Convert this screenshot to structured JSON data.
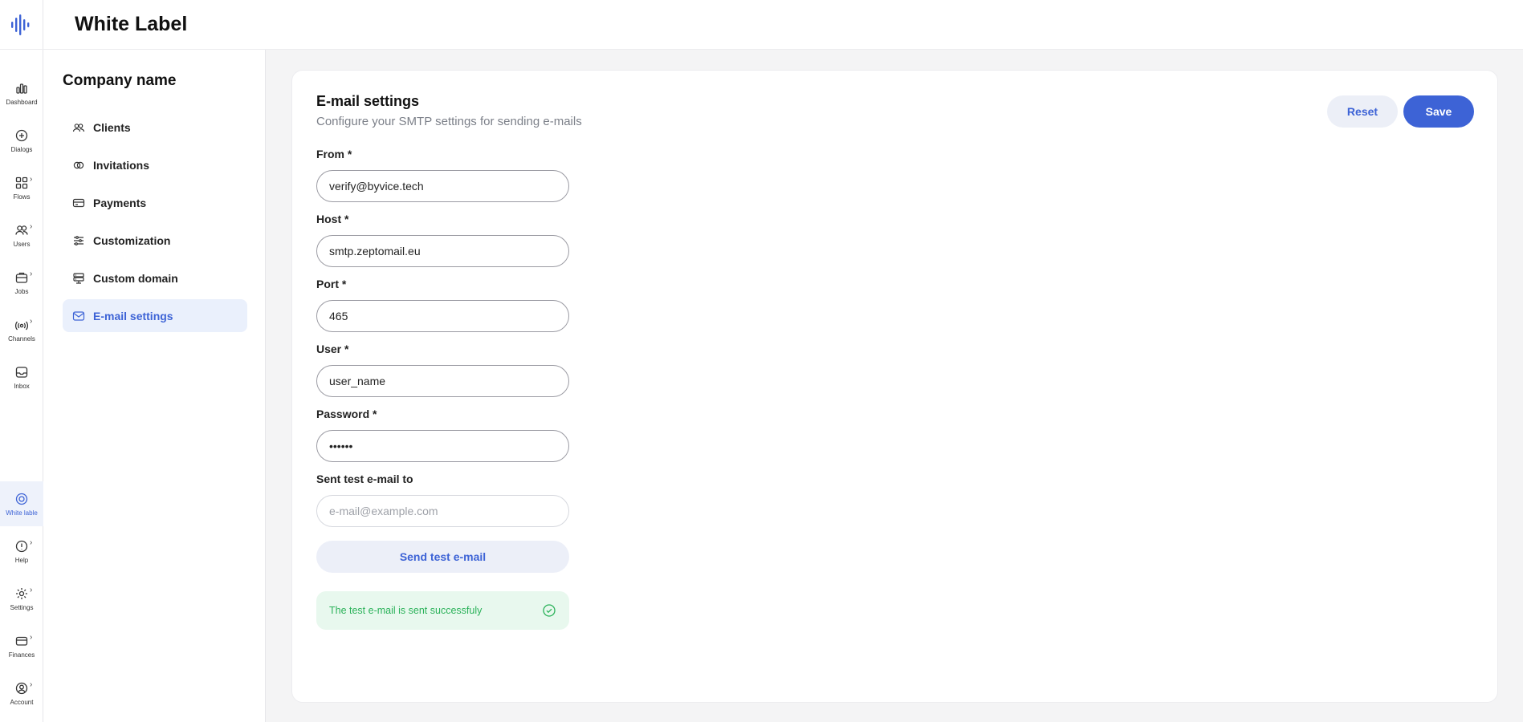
{
  "app": {
    "title": "White Label"
  },
  "rail": {
    "items": [
      {
        "label": "Dashboard",
        "icon": "bar-chart-icon",
        "chevron": false
      },
      {
        "label": "Dialogs",
        "icon": "chat-icon",
        "chevron": false
      },
      {
        "label": "Flows",
        "icon": "grid-icon",
        "chevron": true
      },
      {
        "label": "Users",
        "icon": "users-icon",
        "chevron": true
      },
      {
        "label": "Jobs",
        "icon": "briefcase-icon",
        "chevron": true
      },
      {
        "label": "Channels",
        "icon": "broadcast-icon",
        "chevron": true
      },
      {
        "label": "Inbox",
        "icon": "inbox-icon",
        "chevron": false
      },
      {
        "label": "White lable",
        "icon": "badge-icon",
        "chevron": false,
        "active": true
      },
      {
        "label": "Help",
        "icon": "help-icon",
        "chevron": true
      },
      {
        "label": "Settings",
        "icon": "gear-icon",
        "chevron": true
      },
      {
        "label": "Finances",
        "icon": "wallet-icon",
        "chevron": true
      },
      {
        "label": "Account",
        "icon": "account-icon",
        "chevron": true
      }
    ],
    "chevron_glyph": "›"
  },
  "subnav": {
    "company": "Company name",
    "items": [
      {
        "label": "Clients",
        "icon": "clients-icon"
      },
      {
        "label": "Invitations",
        "icon": "link-icon"
      },
      {
        "label": "Payments",
        "icon": "card-icon"
      },
      {
        "label": "Customization",
        "icon": "sliders-icon"
      },
      {
        "label": "Custom domain",
        "icon": "server-icon"
      },
      {
        "label": "E-mail settings",
        "icon": "mail-icon",
        "active": true
      }
    ]
  },
  "form": {
    "title": "E-mail settings",
    "subtitle": "Configure your SMTP settings for sending e-mails",
    "reset_label": "Reset",
    "save_label": "Save",
    "from_label": "From *",
    "from_value": "verify@byvice.tech",
    "host_label": "Host *",
    "host_value": "smtp.zeptomail.eu",
    "port_label": "Port *",
    "port_value": "465",
    "user_label": "User *",
    "user_value": "user_name",
    "password_label": "Password *",
    "password_value": "••••••",
    "test_label": "Sent test e-mail to",
    "test_placeholder": "e-mail@example.com",
    "send_test_label": "Send test e-mail",
    "success_message": "The test e-mail is sent successfuly"
  },
  "colors": {
    "accent": "#3d63d6",
    "success": "#2bb25a",
    "success_bg": "#e8f8ee"
  }
}
